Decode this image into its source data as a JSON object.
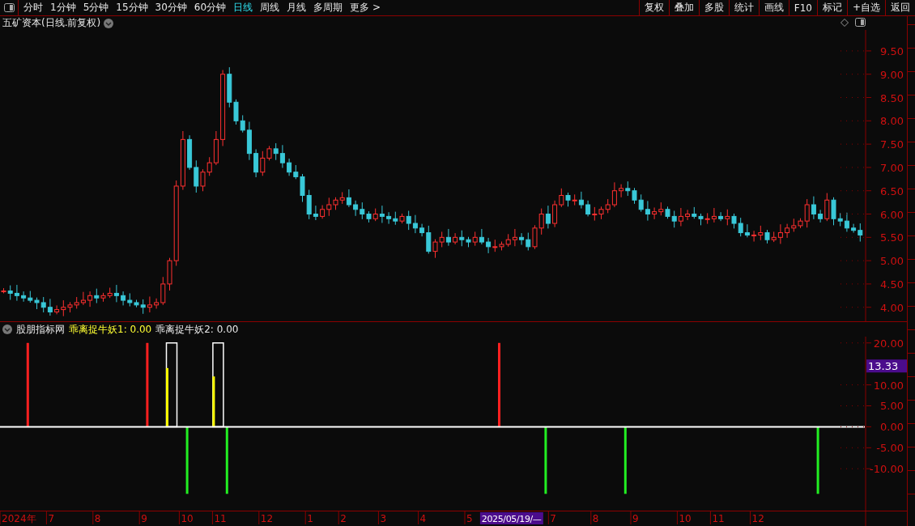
{
  "toolbar": {
    "periods": [
      {
        "label": "分时",
        "selected": false
      },
      {
        "label": "1分钟",
        "selected": false
      },
      {
        "label": "5分钟",
        "selected": false
      },
      {
        "label": "15分钟",
        "selected": false
      },
      {
        "label": "30分钟",
        "selected": false
      },
      {
        "label": "60分钟",
        "selected": false
      },
      {
        "label": "日线",
        "selected": true
      },
      {
        "label": "周线",
        "selected": false
      },
      {
        "label": "月线",
        "selected": false
      },
      {
        "label": "多周期",
        "selected": false
      },
      {
        "label": "更多 >",
        "selected": false
      }
    ],
    "buttons": [
      "复权",
      "叠加",
      "多股",
      "统计",
      "画线",
      "F10",
      "标记",
      "+自选",
      "返回"
    ]
  },
  "price_panel": {
    "title": "五矿资本(日线.前复权)",
    "axis_labels": [
      "9.50",
      "9.00",
      "8.50",
      "8.00",
      "7.50",
      "7.00",
      "6.50",
      "6.00",
      "5.50",
      "5.00",
      "4.50",
      "4.00"
    ]
  },
  "indicator_panel": {
    "legend": [
      {
        "text": "股朋指标网",
        "kind": "title"
      },
      {
        "text": "乖离捉牛妖1: 0.00",
        "kind": "highlight"
      },
      {
        "text": "乖离捉牛妖2: 0.00",
        "kind": "plain"
      }
    ],
    "cursor_value": "13.33",
    "axis_labels": [
      "20.00",
      "10.00",
      "5.00",
      "0.00",
      "-5.00",
      "-10.00"
    ]
  },
  "date_axis": {
    "labels": [
      {
        "text": "2024年",
        "selected": false
      },
      {
        "text": "7",
        "selected": false
      },
      {
        "text": "8",
        "selected": false
      },
      {
        "text": "9",
        "selected": false
      },
      {
        "text": "10",
        "selected": false
      },
      {
        "text": "11",
        "selected": false
      },
      {
        "text": "12",
        "selected": false
      },
      {
        "text": "1",
        "selected": false
      },
      {
        "text": "2",
        "selected": false
      },
      {
        "text": "3",
        "selected": false
      },
      {
        "text": "4",
        "selected": false
      },
      {
        "text": "5",
        "selected": false
      },
      {
        "text": "2025/05/19/—",
        "selected": true
      },
      {
        "text": "7",
        "selected": false
      },
      {
        "text": "8",
        "selected": false
      },
      {
        "text": "9",
        "selected": false
      },
      {
        "text": "10",
        "selected": false
      },
      {
        "text": "11",
        "selected": false
      },
      {
        "text": "12",
        "selected": false
      }
    ]
  }
}
